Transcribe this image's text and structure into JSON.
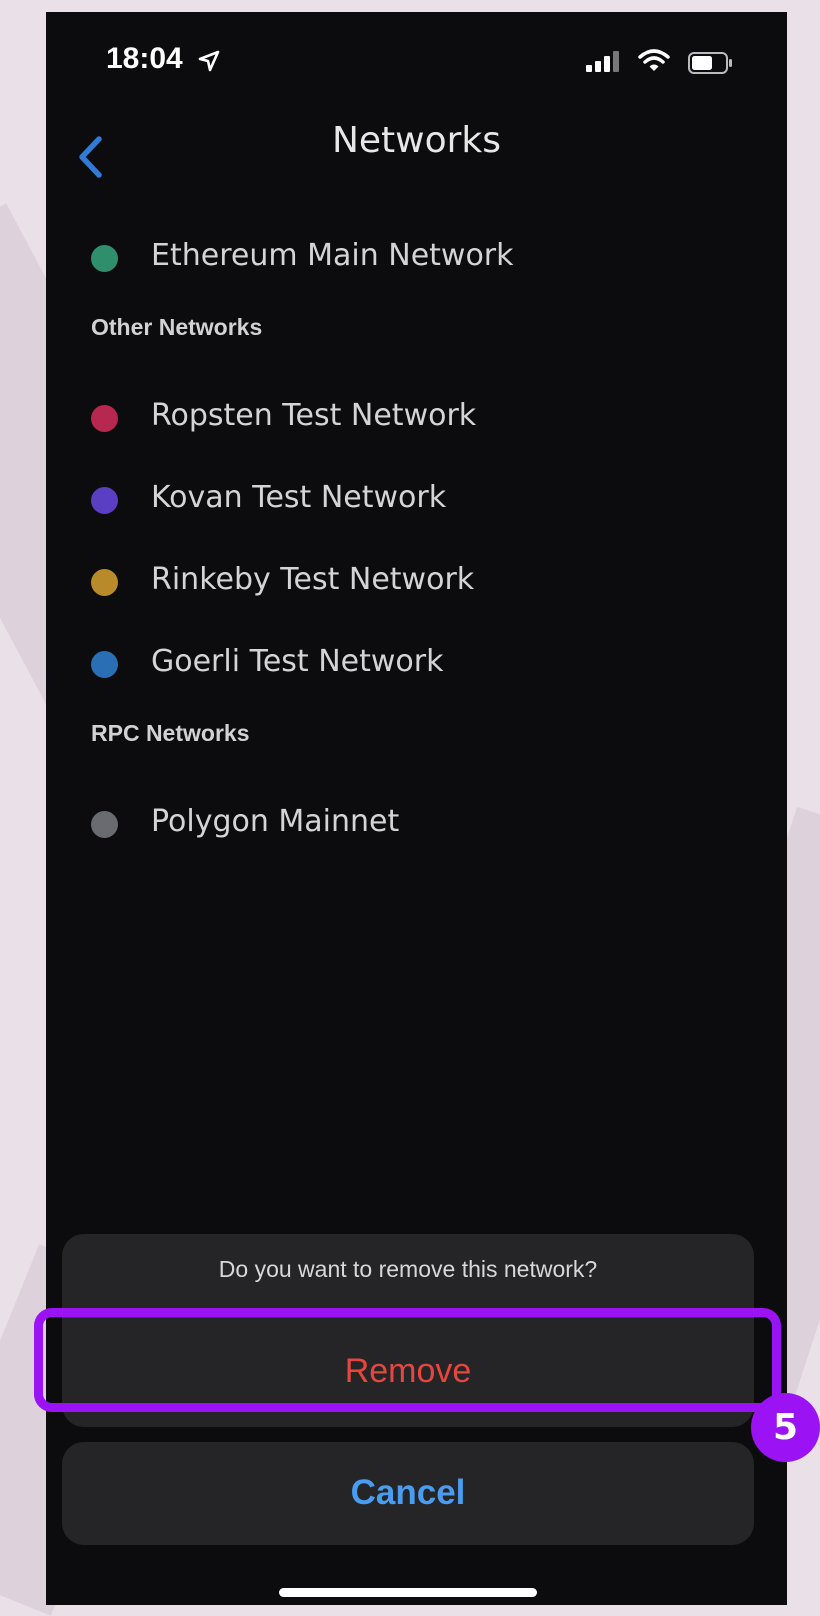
{
  "status_bar": {
    "time": "18:04",
    "icons": [
      "location-arrow-icon",
      "cellular-signal-icon",
      "wifi-icon",
      "battery-icon"
    ]
  },
  "header": {
    "title": "Networks",
    "back_icon": "chevron-left-icon",
    "back_color": "#2f7bd6"
  },
  "networks": {
    "main": {
      "label": "Ethereum Main Network",
      "color": "#2f8f6c"
    },
    "other_heading": "Other Networks",
    "other": [
      {
        "label": "Ropsten Test Network",
        "color": "#b6284f"
      },
      {
        "label": "Kovan Test Network",
        "color": "#5a3fc2"
      },
      {
        "label": "Rinkeby Test Network",
        "color": "#b88a2a"
      },
      {
        "label": "Goerli Test Network",
        "color": "#2a6fb3"
      }
    ],
    "rpc_heading": "RPC Networks",
    "rpc": [
      {
        "label": "Polygon Mainnet",
        "color": "#6a6b70"
      }
    ]
  },
  "action_sheet": {
    "message": "Do you want to remove this network?",
    "remove_label": "Remove",
    "remove_color": "#e7463e",
    "cancel_label": "Cancel",
    "cancel_color": "#4a9cf2"
  },
  "annotation": {
    "step_number": "5",
    "color": "#9b12f4"
  }
}
